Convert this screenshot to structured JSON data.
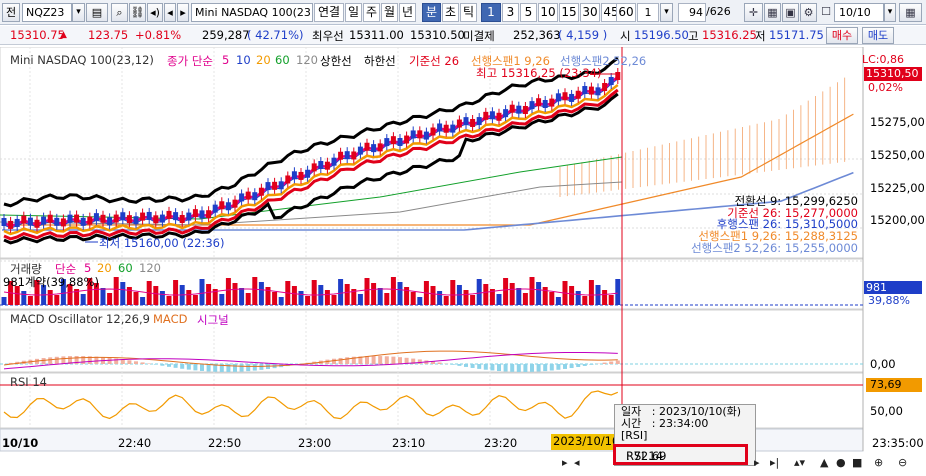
{
  "toolbar": {
    "period_btn": "전",
    "symbol": "NQZ23",
    "search_icon": "search-icon",
    "symbol_name": "Mini NASDAQ 100(23.1",
    "period_tabs": [
      "연결",
      "일",
      "주",
      "월",
      "년",
      "분",
      "초",
      "틱"
    ],
    "selected_period": "분",
    "intervals": [
      "1",
      "3",
      "5",
      "10",
      "15",
      "30",
      "45",
      "60"
    ],
    "selected_interval": "1",
    "interval_value": "1",
    "count_value": "94",
    "count_total": "/626",
    "date": "10/10"
  },
  "quote": {
    "price": "15310.75",
    "change": "123.75",
    "change_pct": "+0.81%",
    "volume": "259,287",
    "volume_ratio": "( 42.71%)",
    "ask_label": "최우선",
    "ask": "15311.00",
    "bid": "15310.50",
    "unfilled_label": "미결제",
    "open_interest": "252,363",
    "oi_change": "( 4,159 )",
    "open_label": "시",
    "open": "15196.50",
    "high_label": "고",
    "high": "15316.25",
    "low_label": "저",
    "low": "15171.75",
    "buy_btn": "매수",
    "sell_btn": "매도"
  },
  "main_panel": {
    "title": "Mini NASDAQ 100(23,12)",
    "ma_label": "종가 단순",
    "ma_periods": [
      "5",
      "10",
      "20",
      "60",
      "120"
    ],
    "extra_labels": [
      "상한선",
      "하한선",
      "기준선 26",
      "선행스팬1 9,26",
      "선행스팬2 52,26"
    ],
    "lc_label": "LC:0,86",
    "price_box": "15310,50",
    "pct_label": "0,02%",
    "high_note": "최고 15316,25 (23:34)",
    "low_note": "최저 15160,00 (22:36)",
    "y_ticks": [
      "15275,00",
      "15250,00",
      "15225,00",
      "15200,00"
    ],
    "ichimoku": [
      "전환선 9: 15,299,6250",
      "기준선 26: 15,277,0000",
      "후행스팬 26: 15,310,5000",
      "선행스팬1 9,26: 15,288,3125",
      "선행스팬2 52,26: 15,255,0000"
    ]
  },
  "volume_panel": {
    "title": "거래량",
    "ma_label": "단순",
    "ma_periods": [
      "5",
      "20",
      "60",
      "120"
    ],
    "note": "981계약(39,88%)",
    "value_box": "981",
    "pct_box": "39,88%"
  },
  "macd_panel": {
    "title": "MACD Oscillator 12,26,9",
    "macd": "MACD",
    "signal": "시그널",
    "zero": "0,00"
  },
  "rsi_panel": {
    "title": "RSI 14",
    "value_box": "73,69",
    "tick": "50,00"
  },
  "x_axis": [
    "10/10",
    "22:40",
    "22:50",
    "23:00",
    "23:10",
    "23:20",
    "23:35:00"
  ],
  "cursor_date": "2023/10/10",
  "popup": {
    "rows": [
      {
        "k": "일자",
        "v": ": 2023/10/10(화)"
      },
      {
        "k": "시간",
        "v": ": 23:34:00"
      },
      {
        "k": "[RSI]",
        "v": ""
      }
    ],
    "rsi_key": "RSI 14",
    "rsi_value": ": 72.69"
  },
  "status_icons": [
    "prev-icon",
    "play-icon",
    "next-icon",
    "end-icon",
    "zoom-out-icon",
    "zoom-in-icon",
    "fit-icon",
    "refresh-icon",
    "settings-icon"
  ],
  "colors": {
    "up": "#e0001a",
    "down": "#1e3ec8",
    "ma5": "#e0008c",
    "ma10": "#1e3ec8",
    "ma20": "#f29a00",
    "ma60": "#12a02a",
    "ma120": "#8a8a8a",
    "kijun": "#e0001a",
    "tenkan": "#000000",
    "span1": "#f08a2a",
    "span2": "#6d8ad6"
  }
}
